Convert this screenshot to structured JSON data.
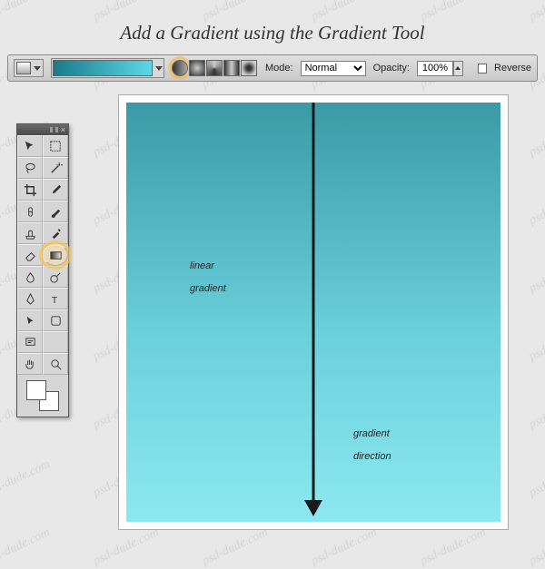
{
  "watermark_text": "psd-dude.com",
  "title": "Add a Gradient using the Gradient Tool",
  "optionsBar": {
    "mode_label": "Mode:",
    "mode_value": "Normal",
    "opacity_label": "Opacity:",
    "opacity_value": "100%",
    "reverse_label": "Reverse",
    "gradient_types": [
      "Linear",
      "Radial",
      "Angle",
      "Reflected",
      "Diamond"
    ],
    "selected_gradient_type": "Linear"
  },
  "toolbox": {
    "tools": [
      "move",
      "marquee",
      "lasso",
      "magic-wand",
      "crop",
      "eyedropper",
      "healing-brush",
      "brush",
      "clone-stamp",
      "history-brush",
      "eraser",
      "gradient",
      "blur",
      "dodge",
      "pen",
      "type",
      "path-select",
      "shape",
      "notes",
      "",
      "hand",
      "zoom"
    ],
    "selected_tool": "gradient",
    "foreground_color": "#ffffff",
    "background_color": "#ffffff"
  },
  "canvas": {
    "label_linear_1": "linear",
    "label_linear_2": "gradient",
    "label_dir_1": "gradient",
    "label_dir_2": "direction"
  }
}
